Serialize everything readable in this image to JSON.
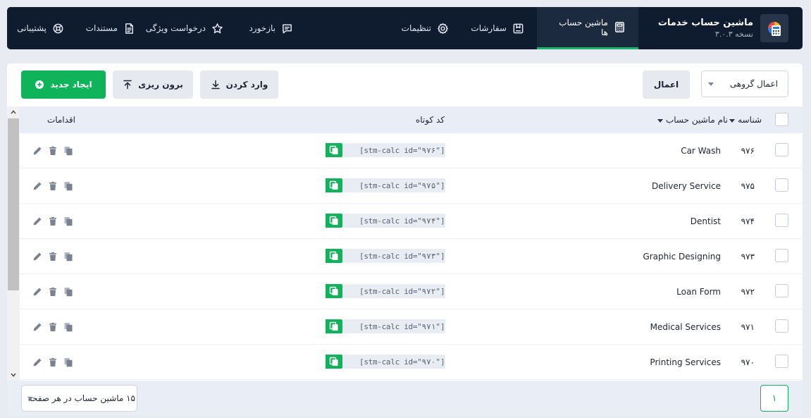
{
  "app": {
    "title": "ماشین حساب خدمات",
    "version": "نسخه ۳.۰.۳"
  },
  "nav": {
    "calculators": "ماشین حساب ها",
    "orders": "سفارشات",
    "settings": "تنظیمات",
    "feedback": "بازخورد",
    "feature_request": "درخواست ویژگی",
    "docs": "مستندات",
    "support": "پشتیبانی"
  },
  "toolbar": {
    "bulk_select": "اعمال گروهی",
    "apply": "اعمال",
    "import": "وارد کردن",
    "export": "برون ریزی",
    "create_new": "ایجاد جدید"
  },
  "table": {
    "headers": {
      "id": "شناسه",
      "name": "نام ماشین حساب",
      "shortcode": "کد کوتاه",
      "actions": "اقدامات"
    },
    "rows": [
      {
        "id": "۹۷۶",
        "name": "Car Wash",
        "shortcode": "[stm-calc id=\"۹۷۶\"]"
      },
      {
        "id": "۹۷۵",
        "name": "Delivery Service",
        "shortcode": "[stm-calc id=\"۹۷۵\"]"
      },
      {
        "id": "۹۷۴",
        "name": "Dentist",
        "shortcode": "[stm-calc id=\"۹۷۴\"]"
      },
      {
        "id": "۹۷۳",
        "name": "Graphic Designing",
        "shortcode": "[stm-calc id=\"۹۷۳\"]"
      },
      {
        "id": "۹۷۲",
        "name": "Loan Form",
        "shortcode": "[stm-calc id=\"۹۷۲\"]"
      },
      {
        "id": "۹۷۱",
        "name": "Medical Services",
        "shortcode": "[stm-calc id=\"۹۷۱\"]"
      },
      {
        "id": "۹۷۰",
        "name": "Printing Services",
        "shortcode": "[stm-calc id=\"۹۷۰\"]"
      }
    ]
  },
  "footer": {
    "page": "۱",
    "per_page": "۱۵ ماشین حساب در هر صفحه"
  },
  "colors": {
    "topbar": "#0f1b2e",
    "accent": "#0fb45a",
    "header_bg": "#e9edf5"
  }
}
